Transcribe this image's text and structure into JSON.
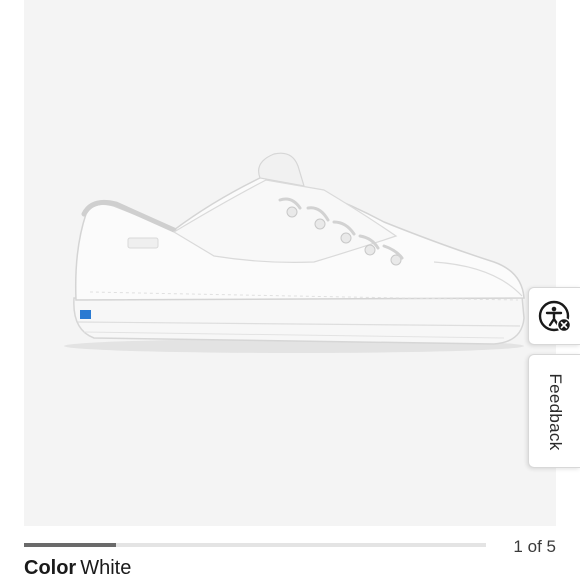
{
  "product": {
    "image_alt": "White leather lace-up sneaker"
  },
  "accessibility": {
    "icon": "accessibility-icon"
  },
  "feedback": {
    "label": "Feedback"
  },
  "carousel": {
    "current": "1",
    "of_text": "of",
    "total": "5",
    "progress_fraction": 0.2
  },
  "color": {
    "label": "Color",
    "value": "White"
  },
  "colors": {
    "brand_badge": "#2a7ad2",
    "background": "#f4f4f4"
  }
}
